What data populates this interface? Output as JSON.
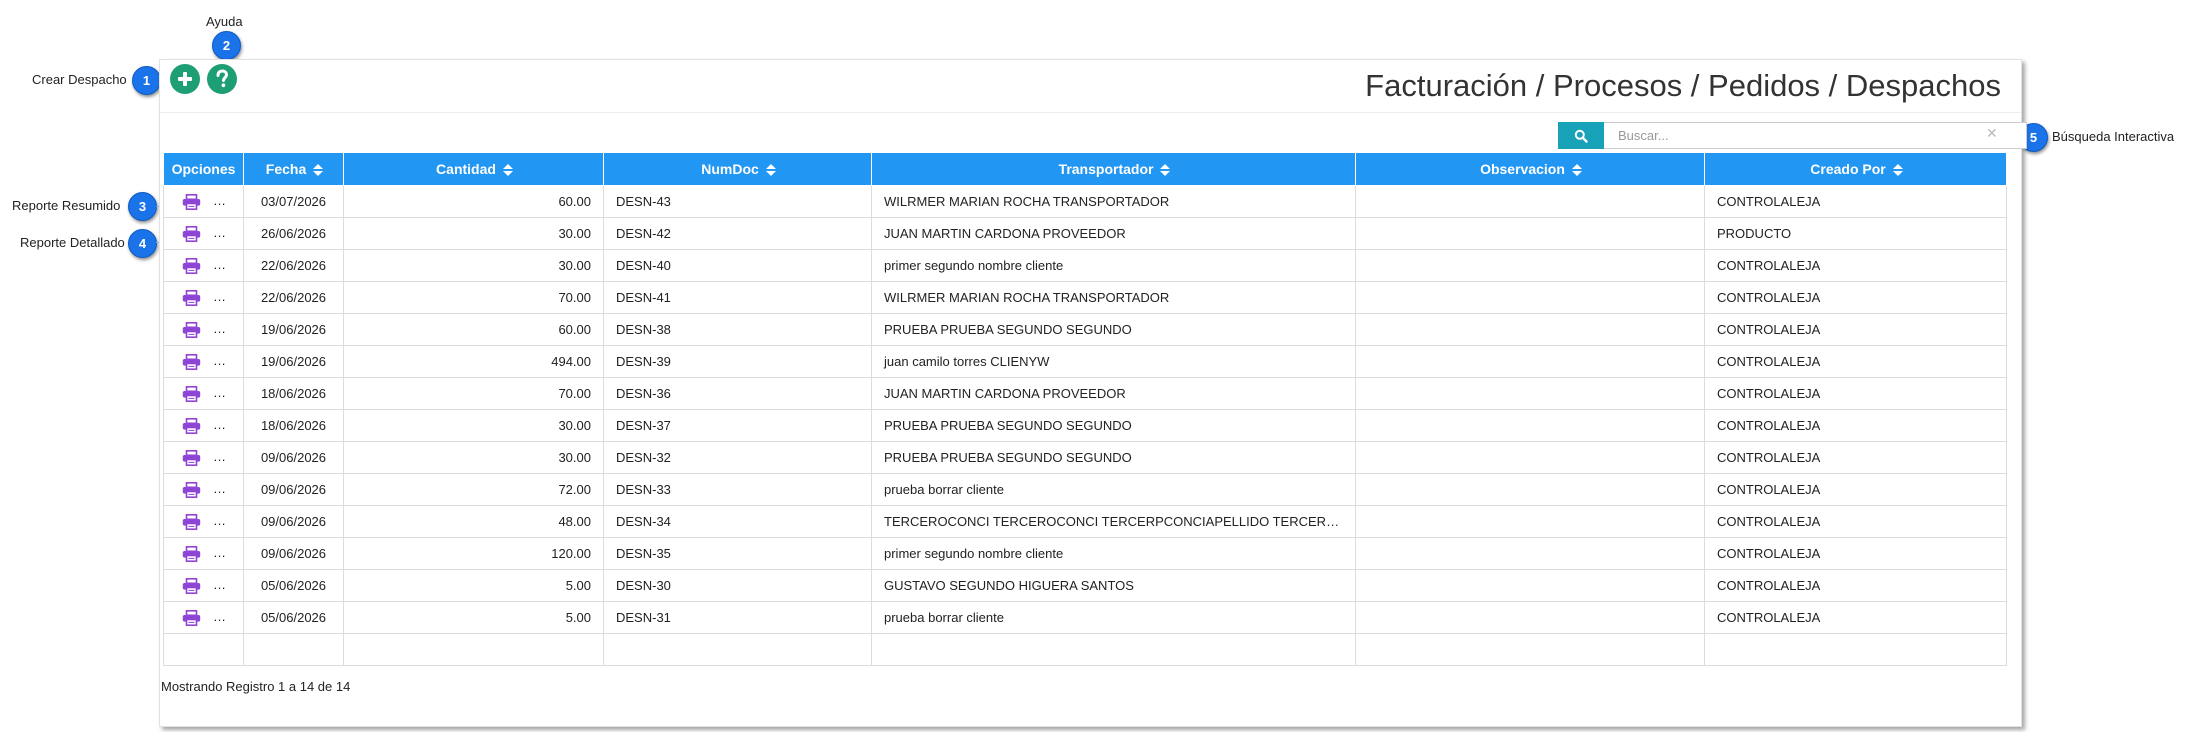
{
  "callouts": {
    "help": {
      "label": "Ayuda",
      "number": "2"
    },
    "create": {
      "label": "Crear Despacho",
      "number": "1"
    },
    "summary_report": {
      "label": "Reporte Resumido",
      "number": "3"
    },
    "detailed_report": {
      "label": "Reporte Detallado",
      "number": "4"
    },
    "search": {
      "label": "Búsqueda Interactiva",
      "number": "5"
    }
  },
  "header": {
    "title": "Facturación / Procesos / Pedidos / Despachos"
  },
  "toolbar": {
    "add_icon": "plus-circle-icon",
    "help_icon": "question-circle-icon"
  },
  "search": {
    "placeholder": "Buscar...",
    "value": "",
    "icon": "search-icon",
    "clear_glyph": "✕"
  },
  "table": {
    "columns": [
      "Opciones",
      "Fecha",
      "Cantidad",
      "NumDoc",
      "Transportador",
      "Observacion",
      "Creado Por"
    ],
    "rows": [
      {
        "fecha": "03/07/2026",
        "cantidad": "60.00",
        "numdoc": "DESN-43",
        "transportador": "WILRMER MARIAN ROCHA TRANSPORTADOR",
        "observacion": "",
        "creado_por": "CONTROLALEJA"
      },
      {
        "fecha": "26/06/2026",
        "cantidad": "30.00",
        "numdoc": "DESN-42",
        "transportador": "JUAN MARTIN CARDONA PROVEEDOR",
        "observacion": "",
        "creado_por": "PRODUCTO"
      },
      {
        "fecha": "22/06/2026",
        "cantidad": "30.00",
        "numdoc": "DESN-40",
        "transportador": "primer segundo nombre cliente",
        "observacion": "",
        "creado_por": "CONTROLALEJA"
      },
      {
        "fecha": "22/06/2026",
        "cantidad": "70.00",
        "numdoc": "DESN-41",
        "transportador": "WILRMER MARIAN ROCHA TRANSPORTADOR",
        "observacion": "",
        "creado_por": "CONTROLALEJA"
      },
      {
        "fecha": "19/06/2026",
        "cantidad": "60.00",
        "numdoc": "DESN-38",
        "transportador": "PRUEBA PRUEBA SEGUNDO SEGUNDO",
        "observacion": "",
        "creado_por": "CONTROLALEJA"
      },
      {
        "fecha": "19/06/2026",
        "cantidad": "494.00",
        "numdoc": "DESN-39",
        "transportador": "juan camilo torres CLIENYW",
        "observacion": "",
        "creado_por": "CONTROLALEJA"
      },
      {
        "fecha": "18/06/2026",
        "cantidad": "70.00",
        "numdoc": "DESN-36",
        "transportador": "JUAN MARTIN CARDONA PROVEEDOR",
        "observacion": "",
        "creado_por": "CONTROLALEJA"
      },
      {
        "fecha": "18/06/2026",
        "cantidad": "30.00",
        "numdoc": "DESN-37",
        "transportador": "PRUEBA PRUEBA SEGUNDO SEGUNDO",
        "observacion": "",
        "creado_por": "CONTROLALEJA"
      },
      {
        "fecha": "09/06/2026",
        "cantidad": "30.00",
        "numdoc": "DESN-32",
        "transportador": "PRUEBA PRUEBA SEGUNDO SEGUNDO",
        "observacion": "",
        "creado_por": "CONTROLALEJA"
      },
      {
        "fecha": "09/06/2026",
        "cantidad": "72.00",
        "numdoc": "DESN-33",
        "transportador": "prueba borrar cliente",
        "observacion": "",
        "creado_por": "CONTROLALEJA"
      },
      {
        "fecha": "09/06/2026",
        "cantidad": "48.00",
        "numdoc": "DESN-34",
        "transportador": "TERCEROCONCI TERCEROCONCI TERCERPCONCIAPELLIDO TERCERPCO...",
        "observacion": "",
        "creado_por": "CONTROLALEJA"
      },
      {
        "fecha": "09/06/2026",
        "cantidad": "120.00",
        "numdoc": "DESN-35",
        "transportador": "primer segundo nombre cliente",
        "observacion": "",
        "creado_por": "CONTROLALEJA"
      },
      {
        "fecha": "05/06/2026",
        "cantidad": "5.00",
        "numdoc": "DESN-30",
        "transportador": "GUSTAVO SEGUNDO HIGUERA SANTOS",
        "observacion": "",
        "creado_por": "CONTROLALEJA"
      },
      {
        "fecha": "05/06/2026",
        "cantidad": "5.00",
        "numdoc": "DESN-31",
        "transportador": "prueba borrar cliente",
        "observacion": "",
        "creado_por": "CONTROLALEJA"
      }
    ],
    "row_icons": [
      "printer-summary-icon",
      "printer-detail-icon"
    ]
  },
  "footer": {
    "info": "Mostrando Registro 1 a 14 de 14"
  },
  "colors": {
    "header_bg": "#2196f3",
    "search_btn": "#17a2b8",
    "action_green": "#1e9e74",
    "badge_blue": "#1a73e8",
    "print_purple": "#8e44d4",
    "print_slate": "#4a5870"
  }
}
